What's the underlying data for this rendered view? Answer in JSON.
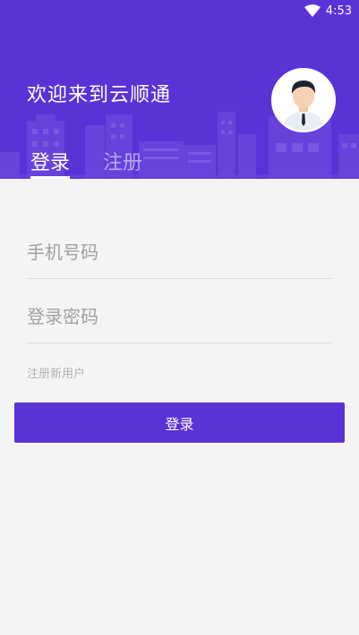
{
  "status_bar": {
    "time": "4:53",
    "wifi_icon": "wifi-icon"
  },
  "header": {
    "welcome_text": "欢迎来到云顺通",
    "avatar_icon": "user-avatar-icon",
    "background_color": "#5b32d6"
  },
  "tabs": [
    {
      "label": "登录",
      "active": true
    },
    {
      "label": "注册",
      "active": false
    }
  ],
  "form": {
    "phone_placeholder": "手机号码",
    "phone_value": "",
    "password_placeholder": "登录密码",
    "password_value": "",
    "register_link": "注册新用户",
    "submit_label": "登录"
  },
  "colors": {
    "accent": "#5b32d6",
    "background": "#f4f4f5"
  }
}
